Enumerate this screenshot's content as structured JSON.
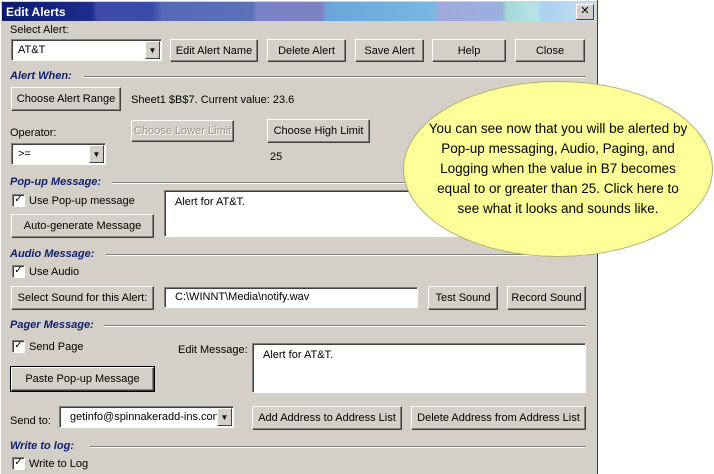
{
  "window": {
    "title": "Edit Alerts",
    "close_glyph": "✕"
  },
  "top": {
    "select_alert_label": "Select Alert:",
    "select_alert_value": "AT&T",
    "buttons": {
      "edit_name": "Edit Alert Name",
      "delete": "Delete Alert",
      "save": "Save Alert",
      "help": "Help",
      "close": "Close"
    }
  },
  "alert_when": {
    "heading": "Alert When:",
    "choose_range": "Choose Alert Range",
    "range_info": "Sheet1 $B$7. Current value: 23.6",
    "operator_label": "Operator:",
    "operator_value": ">=",
    "choose_lower": "Choose Lower Limit",
    "choose_high": "Choose High Limit",
    "high_value": "25"
  },
  "popup": {
    "heading": "Pop-up Message:",
    "use_label": "Use Pop-up message",
    "auto_button": "Auto-generate Message",
    "message": "Alert for AT&T."
  },
  "audio": {
    "heading": "Audio Message:",
    "use_label": "Use Audio",
    "select_button": "Select Sound for this Alert:",
    "path": "C:\\WINNT\\Media\\notify.wav",
    "test_button": "Test Sound",
    "record_button": "Record Sound"
  },
  "pager": {
    "heading": "Pager Message:",
    "send_label": "Send Page",
    "edit_label": "Edit Message:",
    "paste_button": "Paste Pop-up Message",
    "message": "Alert for AT&T.",
    "send_to_label": "Send to:",
    "send_to_value": "getinfo@spinnakeradd-ins.con",
    "add_button": "Add Address to Address List",
    "delete_button": "Delete Address from Address List"
  },
  "log": {
    "heading": "Write to log:",
    "write_label": "Write to Log"
  },
  "tooltip": {
    "text": "You can see now that you will be alerted by Pop-up messaging, Audio, Paging, and Logging when the value in B7 becomes equal to or greater than 25. Click here to see what it looks and sounds like."
  },
  "check_glyph": "✓",
  "arrow_glyph": "▼"
}
